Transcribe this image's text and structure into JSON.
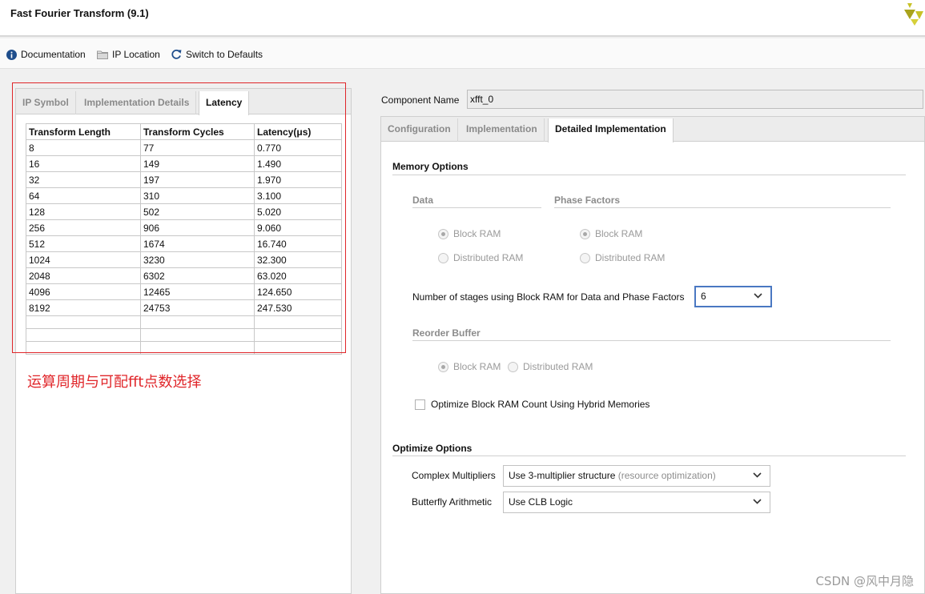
{
  "window": {
    "title": "Fast Fourier Transform (9.1)"
  },
  "toolbar": {
    "documentation": "Documentation",
    "ip_location": "IP Location",
    "switch_defaults": "Switch to Defaults"
  },
  "left_tabs": [
    "IP Symbol",
    "Implementation Details",
    "Latency"
  ],
  "latency_table": {
    "headers": [
      "Transform Length",
      "Transform Cycles",
      "Latency(μs)"
    ],
    "rows": [
      [
        "8",
        "77",
        "0.770"
      ],
      [
        "16",
        "149",
        "1.490"
      ],
      [
        "32",
        "197",
        "1.970"
      ],
      [
        "64",
        "310",
        "3.100"
      ],
      [
        "128",
        "502",
        "5.020"
      ],
      [
        "256",
        "906",
        "9.060"
      ],
      [
        "512",
        "1674",
        "16.740"
      ],
      [
        "1024",
        "3230",
        "32.300"
      ],
      [
        "2048",
        "6302",
        "63.020"
      ],
      [
        "4096",
        "12465",
        "124.650"
      ],
      [
        "8192",
        "24753",
        "247.530"
      ]
    ]
  },
  "annotation": "运算周期与可配fft点数选择",
  "component": {
    "label": "Component Name",
    "value": "xfft_0"
  },
  "right_tabs": [
    "Configuration",
    "Implementation",
    "Detailed Implementation"
  ],
  "memory": {
    "title": "Memory Options",
    "data_label": "Data",
    "phase_label": "Phase Factors",
    "block_ram": "Block RAM",
    "distributed_ram": "Distributed RAM",
    "stages_label": "Number of stages using Block RAM for Data and Phase Factors",
    "stages_value": "6",
    "reorder_label": "Reorder Buffer",
    "hybrid_label": "Optimize Block RAM Count Using Hybrid Memories"
  },
  "optimize": {
    "title": "Optimize Options",
    "complex_label": "Complex Multipliers",
    "complex_value": "Use 3-multiplier structure",
    "complex_note": "(resource optimization)",
    "butterfly_label": "Butterfly Arithmetic",
    "butterfly_value": "Use CLB Logic"
  },
  "watermark": "CSDN @风中月隐",
  "colors": {
    "annotation_red": "#e0262a",
    "focus_blue": "#4a78c2",
    "logo_yellow": "#c8c227"
  }
}
